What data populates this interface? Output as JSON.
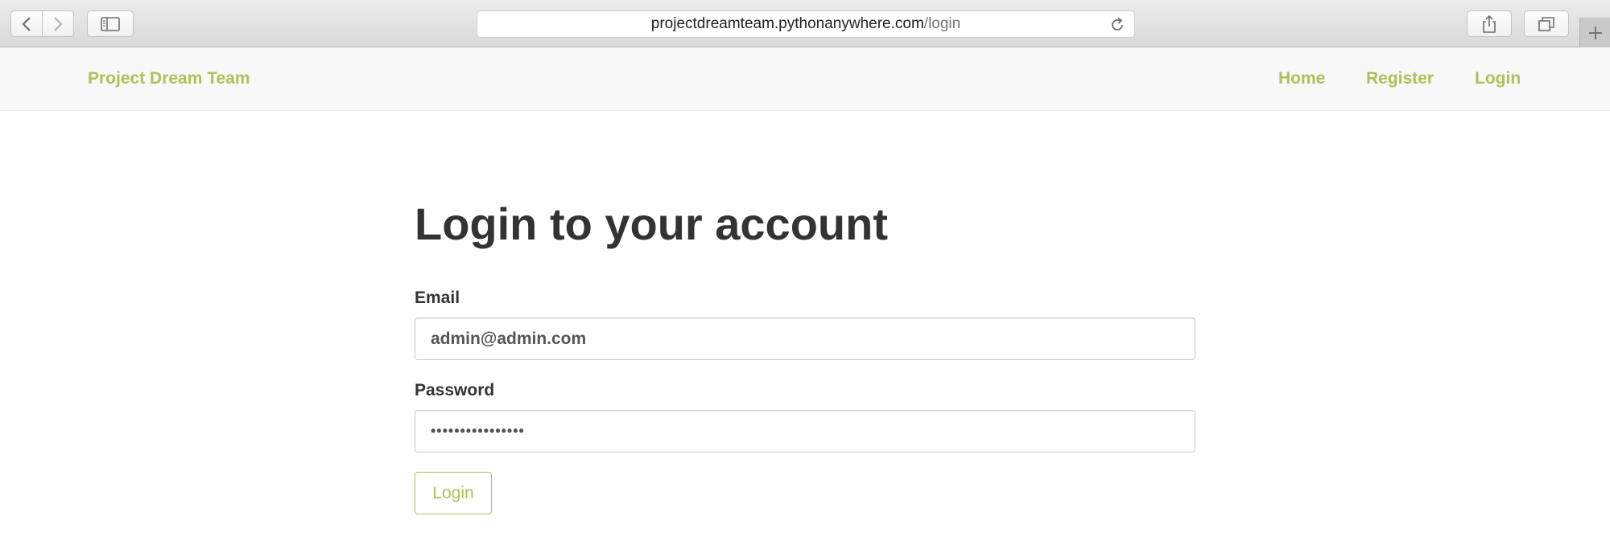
{
  "browser": {
    "url_host": "projectdreamteam.pythonanywhere.com",
    "url_path": "/login",
    "icons": {
      "back": "chevron-left-icon",
      "forward": "chevron-right-icon",
      "sidebar": "sidebar-icon",
      "reload": "reload-icon",
      "share": "share-icon",
      "tabs": "tabs-overview-icon",
      "new_tab": "plus-icon"
    }
  },
  "navbar": {
    "brand": "Project Dream Team",
    "links": [
      "Home",
      "Register",
      "Login"
    ]
  },
  "form": {
    "title": "Login to your account",
    "email_label": "Email",
    "email_value": "admin@admin.com",
    "password_label": "Password",
    "password_value": "••••••••••••••••",
    "submit_label": "Login"
  },
  "colors": {
    "accent": "#aac256",
    "text": "#333333",
    "navbar_bg": "#f8f8f8"
  }
}
